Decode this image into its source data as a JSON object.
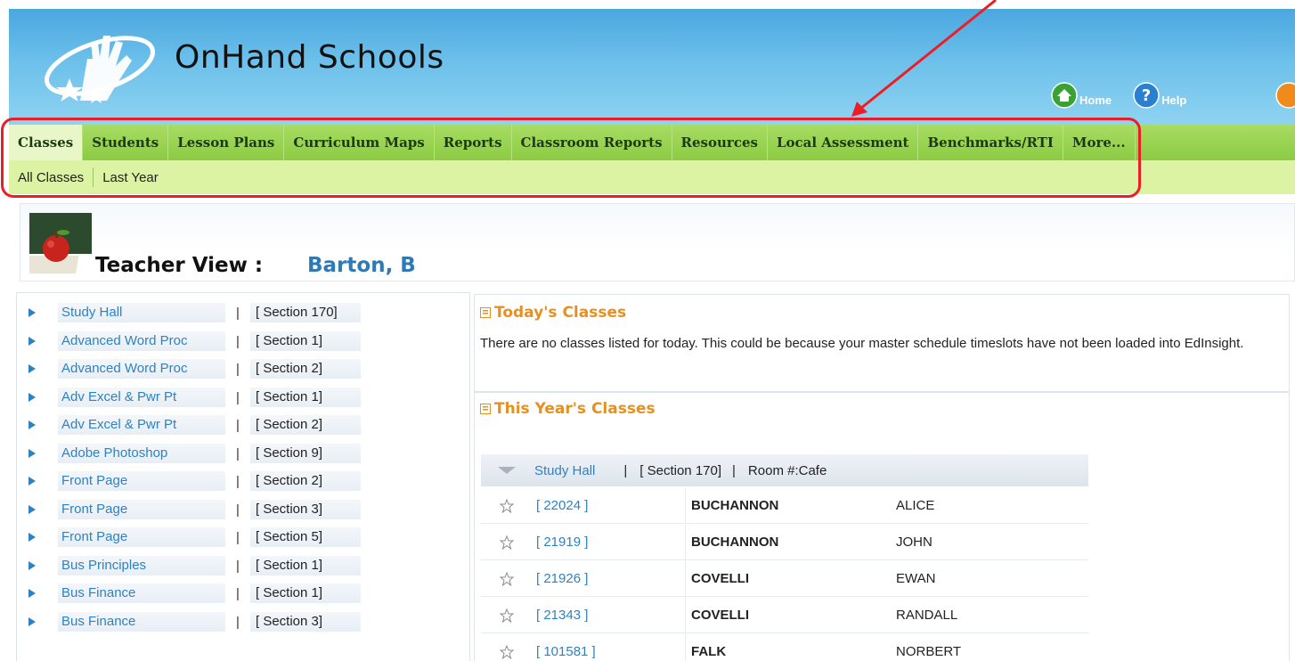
{
  "header": {
    "brand": "OnHand Schools",
    "links": [
      {
        "label": "Home",
        "icon": "home-icon"
      },
      {
        "label": "Help",
        "icon": "help-icon"
      }
    ]
  },
  "nav": {
    "tabs": [
      "Classes",
      "Students",
      "Lesson Plans",
      "Curriculum Maps",
      "Reports",
      "Classroom Reports",
      "Resources",
      "Local Assessment",
      "Benchmarks/RTI",
      "More..."
    ],
    "active_tab": "Classes",
    "subtabs": [
      "All Classes",
      "Last Year"
    ]
  },
  "banner": {
    "title": "Teacher View :",
    "teacher_name": "Barton, B"
  },
  "class_list": {
    "separator": "|",
    "items": [
      {
        "name": "Study Hall",
        "section": "[ Section 170]"
      },
      {
        "name": "Advanced Word Proc",
        "section": "[ Section 1]"
      },
      {
        "name": "Advanced Word Proc",
        "section": "[ Section 2]"
      },
      {
        "name": "Adv Excel & Pwr Pt",
        "section": "[ Section 1]"
      },
      {
        "name": "Adv Excel & Pwr Pt",
        "section": "[ Section 2]"
      },
      {
        "name": "Adobe Photoshop",
        "section": "[ Section 9]"
      },
      {
        "name": "Front Page",
        "section": "[ Section 2]"
      },
      {
        "name": "Front Page",
        "section": "[ Section 3]"
      },
      {
        "name": "Front Page",
        "section": "[ Section 5]"
      },
      {
        "name": "Bus Principles",
        "section": "[ Section 1]"
      },
      {
        "name": "Bus Finance",
        "section": "[ Section 1]"
      },
      {
        "name": "Bus Finance",
        "section": "[ Section 3]"
      }
    ]
  },
  "today": {
    "title": "Today's Classes",
    "message": "There are no classes listed for today. This could be because your master schedule timeslots have not been loaded into EdInsight."
  },
  "this_year": {
    "title": "This Year's Classes",
    "schedule_header": {
      "class_name": "Study Hall",
      "separator": "|",
      "section": "[ Section 170]",
      "room": "Room #:Cafe"
    },
    "students": [
      {
        "id": "[ 22024 ]",
        "last": "BUCHANNON",
        "first": "ALICE"
      },
      {
        "id": "[ 21919 ]",
        "last": "BUCHANNON",
        "first": "JOHN"
      },
      {
        "id": "[ 21926 ]",
        "last": "COVELLI",
        "first": "EWAN"
      },
      {
        "id": "[ 21343 ]",
        "last": "COVELLI",
        "first": "RANDALL"
      },
      {
        "id": "[ 101581 ]",
        "last": "FALK",
        "first": "NORBERT"
      }
    ]
  },
  "colors": {
    "nav_green": "#8ccb43",
    "subnav_green": "#dcf3a3",
    "link_blue": "#2e82c2",
    "panel_title_orange": "#e8901e",
    "annotation_red": "#ee1c24"
  }
}
